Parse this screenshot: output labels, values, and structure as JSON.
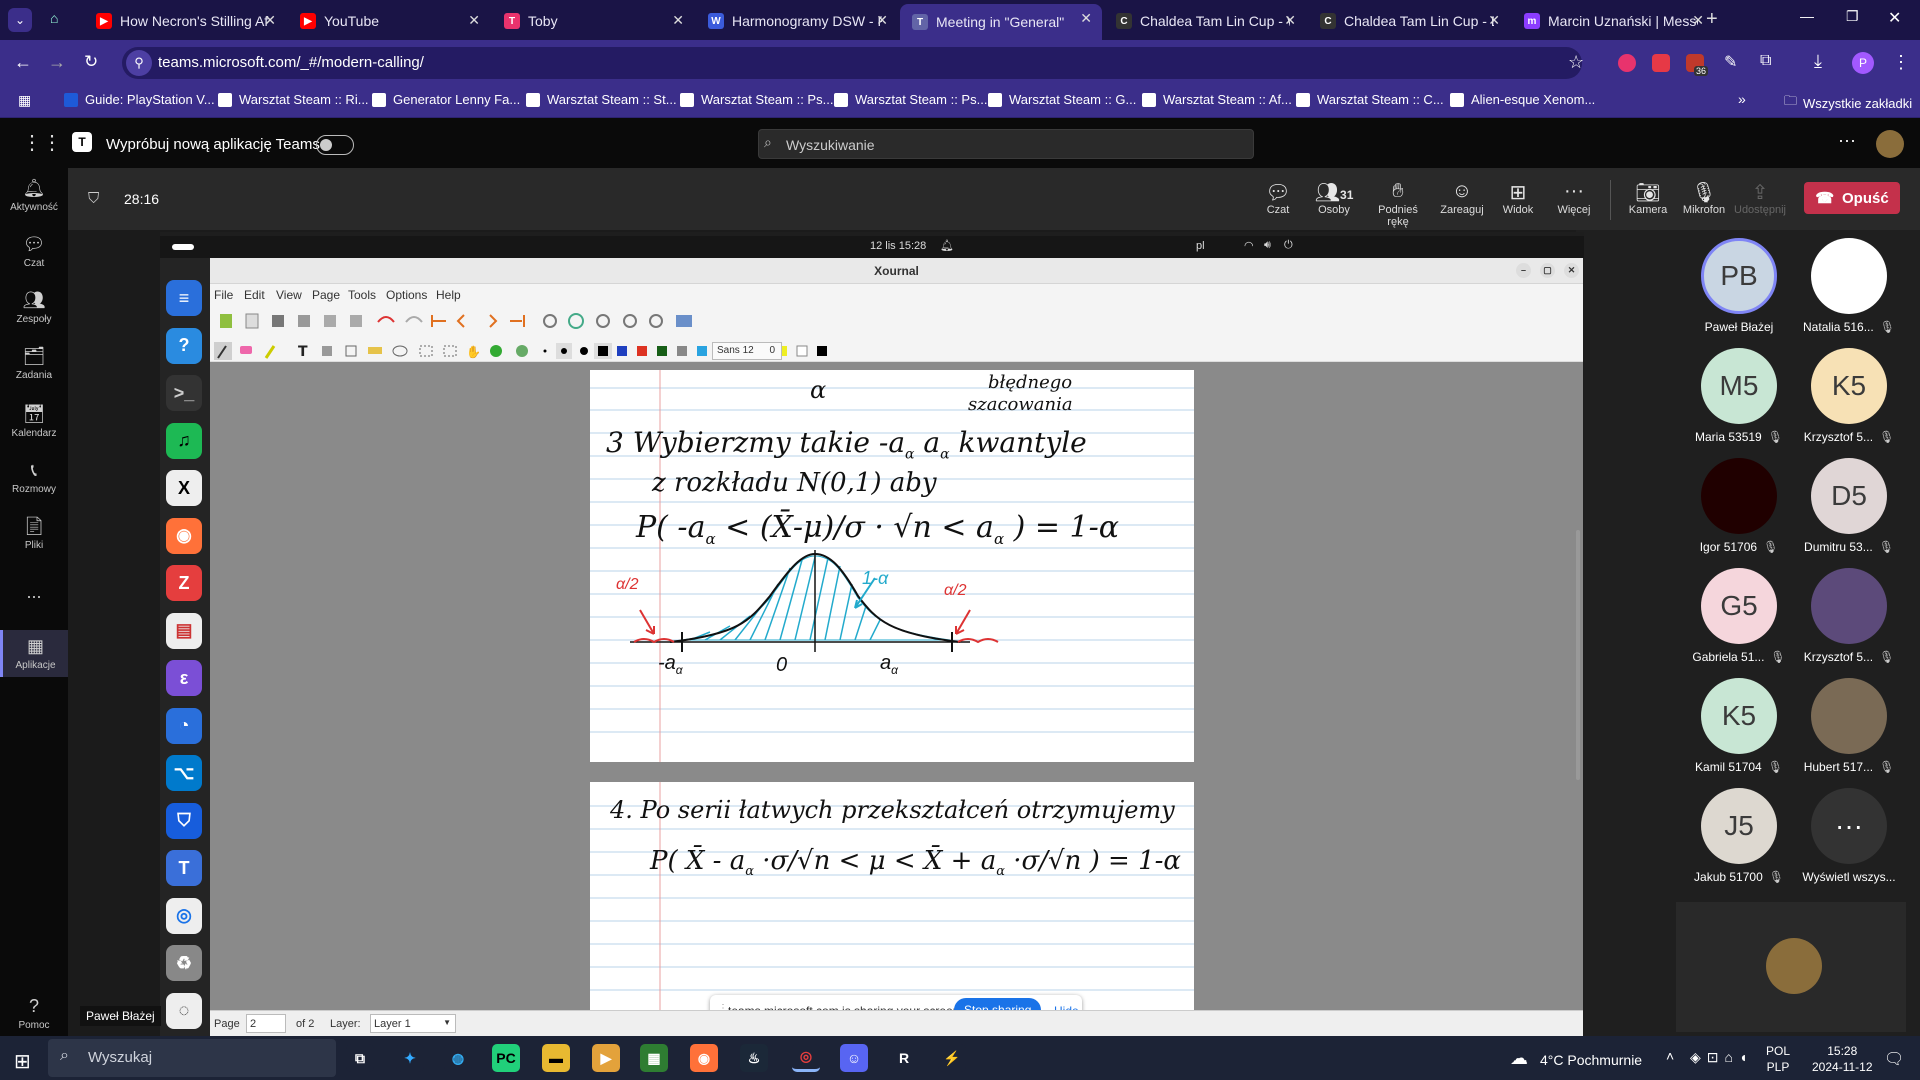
{
  "browser": {
    "tabs": [
      {
        "title": "How Necron's Stilling Af",
        "color": "#ff0000",
        "glyph": "▶"
      },
      {
        "title": "YouTube",
        "color": "#ff0000",
        "glyph": "▶"
      },
      {
        "title": "Toby",
        "color": "#e8336d",
        "glyph": "T"
      },
      {
        "title": "Harmonogramy DSW - P",
        "color": "#3b5bdb",
        "glyph": "W"
      },
      {
        "title": "Meeting in \"General\"",
        "color": "#6264a7",
        "glyph": "T"
      },
      {
        "title": "Chaldea Tam Lin Cup - W",
        "color": "#333333",
        "glyph": "C"
      },
      {
        "title": "Chaldea Tam Lin Cup - E",
        "color": "#333333",
        "glyph": "C"
      },
      {
        "title": "Marcin Uznański | Messe",
        "color": "#8b3dff",
        "glyph": "m"
      }
    ],
    "url": "teams.microsoft.com/_#/modern-calling/",
    "profile_initial": "P",
    "extension_badge": "36",
    "bookmarks": [
      "Guide: PlayStation V...",
      "Warsztat Steam :: Ri...",
      "Generator Lenny Fa...",
      "Warsztat Steam :: St...",
      "Warsztat Steam :: Ps...",
      "Warsztat Steam :: Ps...",
      "Warsztat Steam :: G...",
      "Warsztat Steam :: Af...",
      "Warsztat Steam :: C...",
      "Alien-esque Xenom..."
    ],
    "all_bookmarks": "Wszystkie zakładki"
  },
  "teams": {
    "try_new": "Wypróbuj nową aplikację Teams",
    "search_placeholder": "Wyszukiwanie",
    "rail": [
      "Aktywność",
      "Czat",
      "Zespoły",
      "Zadania",
      "Kalendarz",
      "Rozmowy",
      "Pliki",
      "...",
      "Aplikacje",
      "Pomoc"
    ],
    "timer": "28:16",
    "meeting_controls": {
      "chat": "Czat",
      "people": "Osoby",
      "people_count": "31",
      "raise": "Podnieś rękę",
      "react": "Zareaguj",
      "view": "Widok",
      "more": "Więcej",
      "camera": "Kamera",
      "mic": "Mikrofon",
      "share": "Udostępnij",
      "leave": "Opuść"
    },
    "presenter_tooltip": "Paweł Błażej",
    "participants": [
      {
        "initials": "PB",
        "name": "Paweł Błażej",
        "bg": "#c9d6e3",
        "muted": false
      },
      {
        "initials": "",
        "name": "Natalia 516...",
        "bg": "#ffffff",
        "muted": true
      },
      {
        "initials": "M5",
        "name": "Maria 53519",
        "bg": "#c8e6d4",
        "muted": true
      },
      {
        "initials": "K5",
        "name": "Krzysztof 5...",
        "bg": "#f7e1b5",
        "muted": true
      },
      {
        "initials": "",
        "name": "Igor 51706",
        "bg": "#200000",
        "muted": true
      },
      {
        "initials": "D5",
        "name": "Dumitru 53...",
        "bg": "#e0d6d6",
        "muted": true
      },
      {
        "initials": "G5",
        "name": "Gabriela 51...",
        "bg": "#f5d6dc",
        "muted": true
      },
      {
        "initials": "",
        "name": "Krzysztof 5...",
        "bg": "#5c4a7a",
        "muted": true
      },
      {
        "initials": "K5",
        "name": "Kamil 51704",
        "bg": "#c8e6d4",
        "muted": true
      },
      {
        "initials": "",
        "name": "Hubert 517...",
        "bg": "#7a6a55",
        "muted": true
      },
      {
        "initials": "J5",
        "name": "Jakub 51700",
        "bg": "#ddd8d0",
        "muted": true
      },
      {
        "initials": "···",
        "name": "Wyświetl wszys...",
        "bg": "#333333",
        "muted": false
      }
    ]
  },
  "shared": {
    "clock": "12 lis 15:28",
    "lang": "pl",
    "window_title": "Xournal",
    "menu": [
      "File",
      "Edit",
      "View",
      "Page",
      "Tools",
      "Options",
      "Help"
    ],
    "font": "Sans 12",
    "font_size_box": "0",
    "page_label": "Page",
    "page_num": "2",
    "page_of": "of 2",
    "layer_label": "Layer:",
    "layer_value": "Layer 1",
    "share_msg": "teams.microsoft.com is sharing your screen.",
    "stop_sharing": "Stop sharing",
    "hide": "Hide",
    "notes": {
      "l_alpha": "α",
      "l_bledne1": "błędnego",
      "l_bledne2": "szacowania",
      "l3a": "3  Wybierzmy takie -a",
      "l3b": "a",
      "l3c": "kwantyle",
      "l4": "z rozkładu N(0,1) aby",
      "eq1": "P( -a",
      "eq1b": "< (X̄-μ)/σ · √n < a",
      "eq1c": ") = 1-α",
      "half1": "α/2",
      "half2": "α/2",
      "conf": "1-α",
      "ax_l": "-a",
      "ax_0": "0",
      "ax_r": "a",
      "p2l1": "4.  Po serii łatwych przekształceń otrzymujemy",
      "eq2": "P( X̄ - a",
      "eq2b": "·σ/√n < μ < X̄ + a",
      "eq2c": "·σ/√n ) = 1-α"
    }
  },
  "taskbar": {
    "search": "Wyszukaj",
    "weather": "4°C Pochmurnie",
    "lang1": "POL",
    "lang2": "PLP",
    "time": "15:28",
    "date": "2024-11-12"
  }
}
